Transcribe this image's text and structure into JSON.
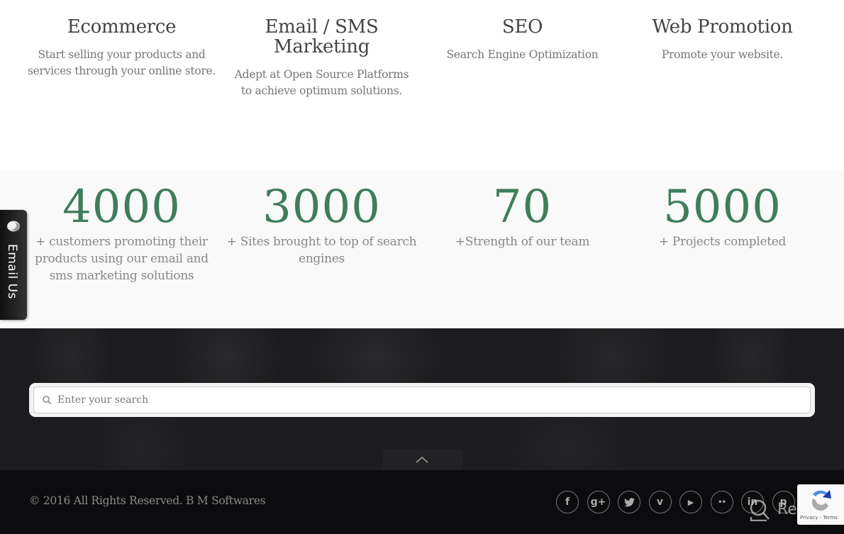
{
  "services": [
    {
      "title": "Ecommerce",
      "description": "Start selling your products and services through your online store."
    },
    {
      "title": "Email / SMS Marketing",
      "description": "Adept at Open Source Platforms to achieve optimum solutions."
    },
    {
      "title": "SEO",
      "description": "Search Engine Optimization"
    },
    {
      "title": "Web Promotion",
      "description": "Promote your website."
    }
  ],
  "stats": [
    {
      "value": "4000",
      "label": "+ customers promoting their products using our email and sms marketing solutions"
    },
    {
      "value": "3000",
      "label": "+ Sites brought to top of search engines"
    },
    {
      "value": "70",
      "label": "+Strength of our team"
    },
    {
      "value": "5000",
      "label": "+ Projects completed"
    }
  ],
  "email_tab": {
    "label": "Email Us",
    "icon": "chat-bubble-icon"
  },
  "search": {
    "placeholder": "Enter your search",
    "value": "",
    "icon": "search-icon"
  },
  "scroll_top": {
    "icon": "chevron-up-icon"
  },
  "footer": {
    "copyright": "© 2016 All Rights Reserved. B M Softwares",
    "socials": [
      {
        "name": "facebook",
        "glyph": "f"
      },
      {
        "name": "google-plus",
        "glyph": "g+"
      },
      {
        "name": "twitter",
        "glyph": "t"
      },
      {
        "name": "vimeo",
        "glyph": "v"
      },
      {
        "name": "youtube",
        "glyph": "▶"
      },
      {
        "name": "flickr",
        "glyph": "••"
      },
      {
        "name": "linkedin",
        "glyph": "in"
      },
      {
        "name": "pinterest",
        "glyph": "p"
      },
      {
        "name": "more",
        "glyph": ""
      }
    ]
  },
  "recaptcha": {
    "terms": "Privacy - Terms"
  },
  "watermark": {
    "text": "Revain"
  },
  "colors": {
    "accent_green": "#3f7d5c",
    "dark_band": "#1c1c1e",
    "footer_bg": "#0c0b0d"
  }
}
